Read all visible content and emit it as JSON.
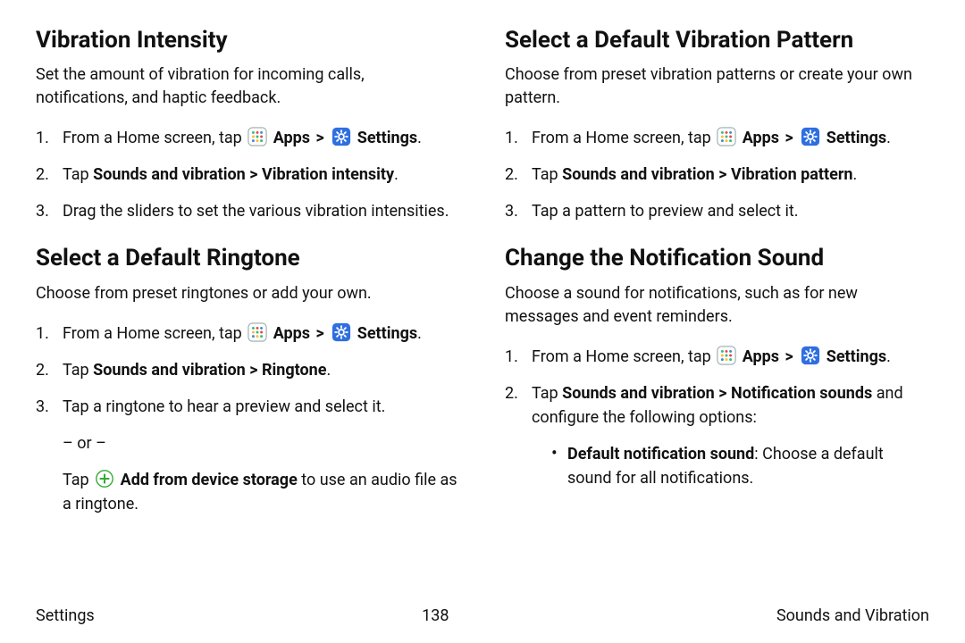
{
  "left": {
    "sec1": {
      "title": "Vibration Intensity",
      "desc": "Set the amount of vibration for incoming calls, notifications, and haptic feedback.",
      "step1a": "From a Home screen, tap ",
      "apps": "Apps",
      "settings": "Settings",
      "step2a": "Tap ",
      "step2b": "Sounds and vibration > Vibration intensity",
      "step3": "Drag the sliders to set the various vibration intensities."
    },
    "sec2": {
      "title": "Select a Default Ringtone",
      "desc": "Choose from preset ringtones or add your own.",
      "step1a": "From a Home screen, tap ",
      "apps": "Apps",
      "settings": "Settings",
      "step2a": "Tap ",
      "step2b": "Sounds and vibration > Ringtone",
      "step3": "Tap a ringtone to hear a preview and select it.",
      "or": "– or –",
      "step3b_pre": "Tap ",
      "step3b_bold": "Add from device storage",
      "step3b_post": " to use an audio file as a ringtone."
    }
  },
  "right": {
    "sec1": {
      "title": "Select a Default Vibration Pattern",
      "desc": "Choose from preset vibration patterns or create your own pattern.",
      "step1a": "From a Home screen, tap ",
      "apps": "Apps",
      "settings": "Settings",
      "step2a": "Tap ",
      "step2b": "Sounds and vibration > Vibration pattern",
      "step3": "Tap a pattern to preview and select it."
    },
    "sec2": {
      "title": "Change the Notification Sound",
      "desc": "Choose a sound for notifications, such as for new messages and event reminders.",
      "step1a": "From a Home screen, tap ",
      "apps": "Apps",
      "settings": "Settings",
      "step2a": "Tap ",
      "step2b": "Sounds and vibration > Notification sounds",
      "step2c": " and configure the following options:",
      "bullet1_bold": "Default notification sound",
      "bullet1_rest": ": Choose a default sound for all notifications."
    }
  },
  "footer": {
    "left": "Settings",
    "center": "138",
    "right": "Sounds and Vibration"
  },
  "glyphs": {
    "chevron": ">",
    "period": "."
  }
}
